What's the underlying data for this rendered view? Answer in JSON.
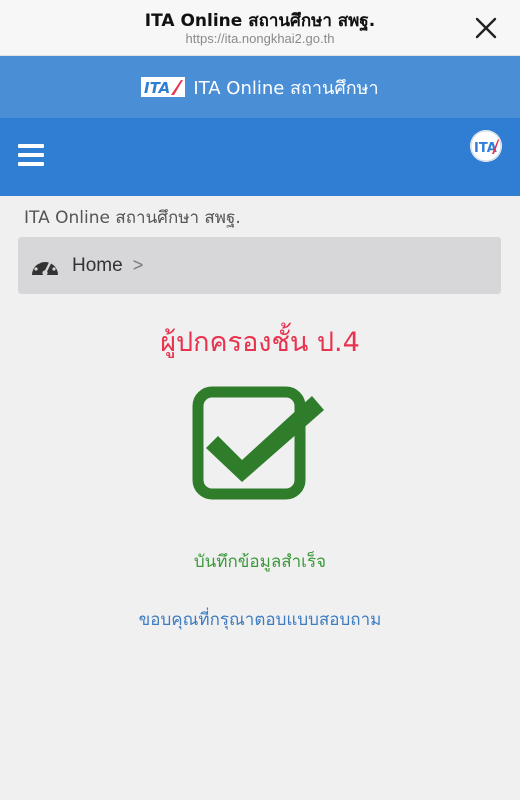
{
  "browser": {
    "title": "ITA Online สถานศึกษา สพฐ.",
    "url": "https://ita.nongkhai2.go.th"
  },
  "header": {
    "logo_text": "ITA",
    "title": "ITA Online สถานศึกษา"
  },
  "nav": {
    "logo_text": "ITA"
  },
  "page": {
    "school_title": "ITA Online สถานศึกษา สพฐ.",
    "breadcrumb": {
      "home": "Home",
      "separator": ">"
    },
    "heading": "ผู้ปกครองชั้น ป.4",
    "success_message": "บันทึกข้อมูลสำเร็จ",
    "thanks_message": "ขอบคุณที่กรุณาตอบแบบสอบถาม"
  },
  "colors": {
    "header_bg": "#4a8ed6",
    "nav_bg": "#2f7ed4",
    "heading": "#e8334f",
    "success": "#3a9a3a",
    "check": "#2f7d2a",
    "thanks": "#3d7cc0"
  }
}
